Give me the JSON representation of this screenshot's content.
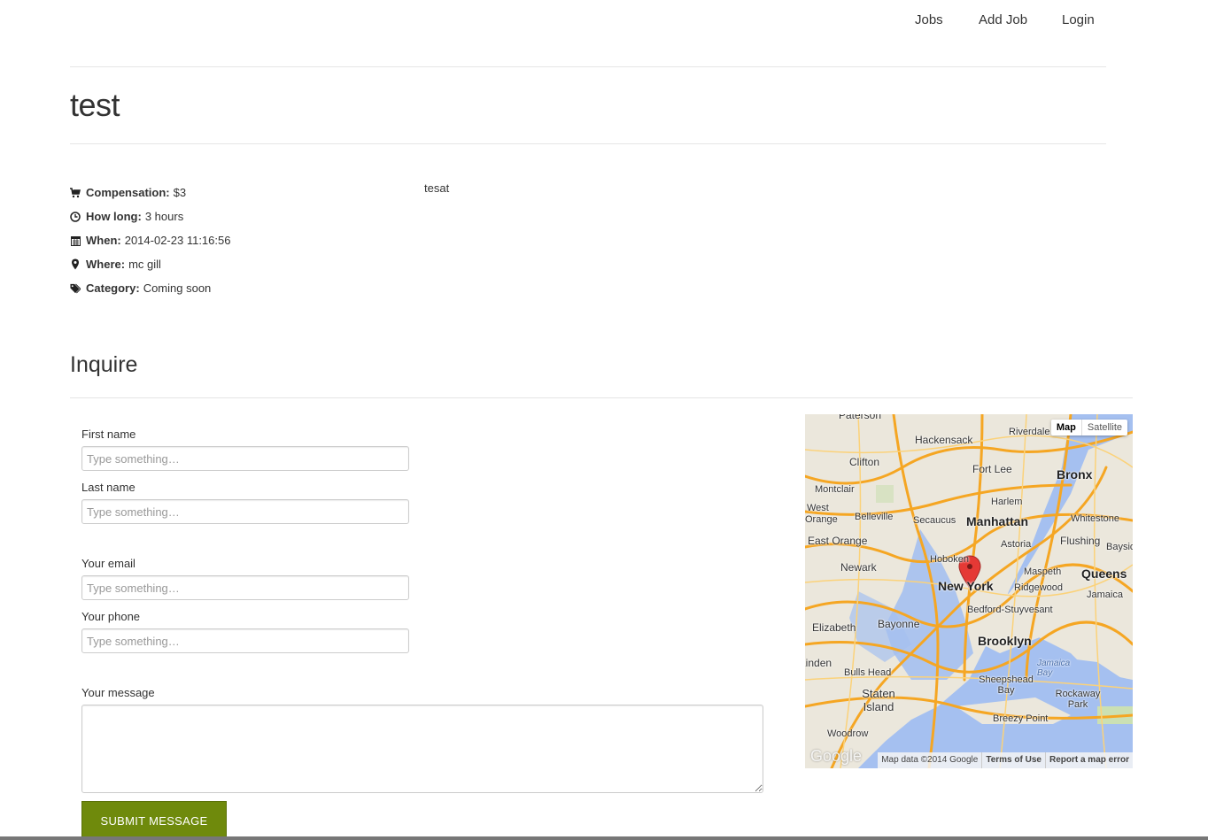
{
  "nav": {
    "items": [
      {
        "label": "Jobs"
      },
      {
        "label": "Add Job"
      },
      {
        "label": "Login"
      }
    ]
  },
  "job": {
    "title": "test",
    "description": "tesat",
    "details": [
      {
        "icon": "cart-icon",
        "label": "Compensation:",
        "value": "$3"
      },
      {
        "icon": "clock-icon",
        "label": "How long:",
        "value": "3 hours"
      },
      {
        "icon": "calendar-icon",
        "label": "When:",
        "value": "2014-02-23 11:16:56"
      },
      {
        "icon": "map-marker-icon",
        "label": "Where:",
        "value": "mc gill"
      },
      {
        "icon": "tags-icon",
        "label": "Category:",
        "value": "Coming soon"
      }
    ]
  },
  "inquire": {
    "title": "Inquire",
    "first_name": {
      "label": "First name",
      "placeholder": "Type something…",
      "value": ""
    },
    "last_name": {
      "label": "Last name",
      "placeholder": "Type something…",
      "value": ""
    },
    "email": {
      "label": "Your email",
      "placeholder": "Type something…",
      "value": ""
    },
    "phone": {
      "label": "Your phone",
      "placeholder": "Type something…",
      "value": ""
    },
    "message": {
      "label": "Your message",
      "value": ""
    },
    "submit_label": "SUBMIT MESSAGE",
    "submit_color": "#6f8a0c"
  },
  "map": {
    "type_buttons": [
      "Map",
      "Satellite"
    ],
    "selected_type": "Map",
    "logo_text": "Google",
    "attribution": "Map data ©2014 Google",
    "terms": "Terms of Use",
    "report": "Report a map error",
    "place_labels": [
      "Paterson",
      "Hackensack",
      "Riverdale",
      "Clifton",
      "Fort Lee",
      "Bronx",
      "Montclair",
      "Harlem",
      "West",
      "Orange",
      "Belleville",
      "Secaucus",
      "Manhattan",
      "Whitestone",
      "East Orange",
      "Astoria",
      "Flushing",
      "Bayside",
      "Newark",
      "Hoboken",
      "Maspeth",
      "Queens",
      "New York",
      "Ridgewood",
      "Jamaica",
      "Bedford-Stuyvesant",
      "Elizabeth",
      "Bayonne",
      "Brooklyn",
      "Linden",
      "Bulls Head",
      "Jamaica Bay",
      "Sheepshead Bay",
      "Staten Island",
      "Rockaway Park",
      "Breezy Point",
      "Woodrow"
    ],
    "marker_color": "#e53935"
  }
}
